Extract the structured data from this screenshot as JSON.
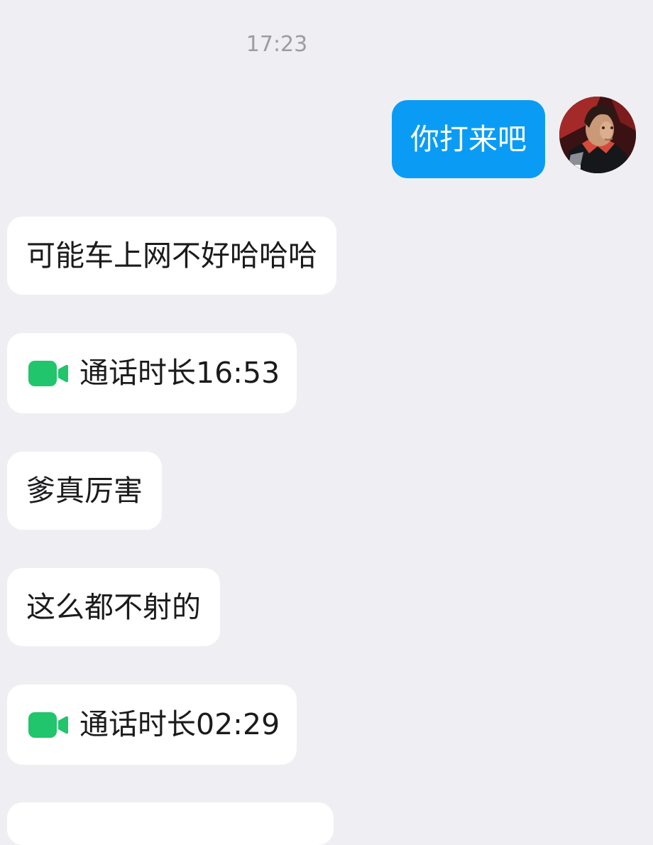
{
  "chat": {
    "timestamp": "17:23",
    "outgoing": [
      {
        "text": "你打来吧"
      }
    ],
    "incoming": [
      {
        "type": "text",
        "text": "可能车上网不好哈哈哈"
      },
      {
        "type": "video_call",
        "icon": "video-camera-icon",
        "text": "通话时长16:53"
      },
      {
        "type": "text",
        "text": "爹真厉害"
      },
      {
        "type": "text",
        "text": "这么都不射的"
      },
      {
        "type": "video_call",
        "icon": "video-camera-icon",
        "text": "通话时长02:29"
      }
    ]
  },
  "colors": {
    "background": "#efeff3",
    "outgoing_bubble": "#0a9cf5",
    "incoming_bubble": "#ffffff",
    "call_icon": "#21c56b",
    "timestamp": "#9c9ca1"
  }
}
